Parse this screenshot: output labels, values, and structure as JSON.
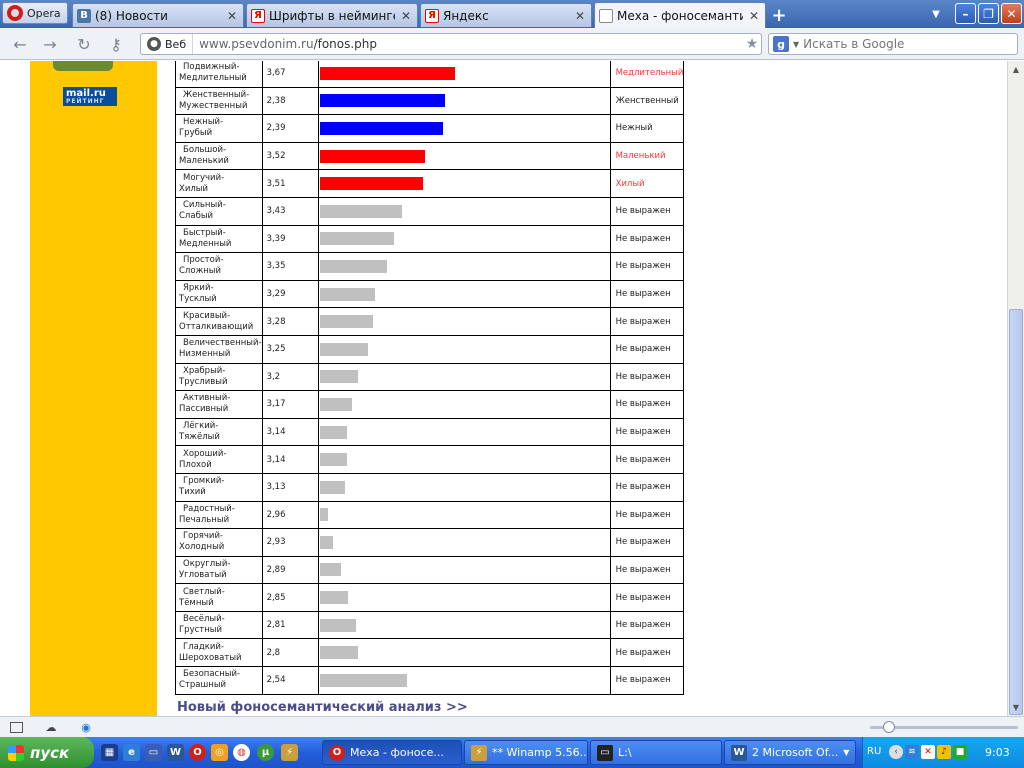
{
  "browser": {
    "menu_label": "Opera",
    "tabs": [
      {
        "label": "(8) Новости",
        "icon": "В"
      },
      {
        "label": "Шрифты в нейминге — ...",
        "icon": "Я"
      },
      {
        "label": "Яндекс",
        "icon": "Я"
      },
      {
        "label": "Меха - фоносемантичес...",
        "icon": "page"
      }
    ],
    "address": {
      "badge": "Веб",
      "domain": "www.psevdonim.ru",
      "path": "/fonos.php"
    },
    "search_placeholder": "Искать в Google"
  },
  "sidebar": {
    "logo_text": "mail.ru",
    "logo_sub": "РЕЙТИНГ"
  },
  "table": {
    "rows": [
      {
        "name1": "Подвижный-",
        "name2": "Медлительный",
        "value": "3,67",
        "bar": 3.67,
        "color": "#ff0000",
        "result": "Медлительный",
        "result_color": "#ff3333"
      },
      {
        "name1": "Женственный-",
        "name2": "Мужественный",
        "value": "2,38",
        "bar": 2.38,
        "color": "#0000ff",
        "result": "Женственный",
        "result_color": "#222222"
      },
      {
        "name1": "Нежный-",
        "name2": "Грубый",
        "value": "2,39",
        "bar": 2.39,
        "color": "#0000ff",
        "result": "Нежный",
        "result_color": "#222222"
      },
      {
        "name1": "Большой-",
        "name2": "Маленький",
        "value": "3,52",
        "bar": 3.52,
        "color": "#ff0000",
        "result": "Маленький",
        "result_color": "#ff3333"
      },
      {
        "name1": "Могучий-",
        "name2": "Хилый",
        "value": "3,51",
        "bar": 3.51,
        "color": "#ff0000",
        "result": "Хилый",
        "result_color": "#ff3333"
      },
      {
        "name1": "Сильный-",
        "name2": "Слабый",
        "value": "3,43",
        "bar": 3.43,
        "color": "#c0c0c0",
        "result": "Не выражен",
        "result_color": "#222222"
      },
      {
        "name1": "Быстрый-",
        "name2": "Медленный",
        "value": "3,39",
        "bar": 3.39,
        "color": "#c0c0c0",
        "result": "Не выражен",
        "result_color": "#222222"
      },
      {
        "name1": "Простой-",
        "name2": "Сложный",
        "value": "3,35",
        "bar": 3.35,
        "color": "#c0c0c0",
        "result": "Не выражен",
        "result_color": "#222222"
      },
      {
        "name1": "Яркий-",
        "name2": "Тусклый",
        "value": "3,29",
        "bar": 3.29,
        "color": "#c0c0c0",
        "result": "Не выражен",
        "result_color": "#222222"
      },
      {
        "name1": "Красивый-",
        "name2": "Отталкивающий",
        "value": "3,28",
        "bar": 3.28,
        "color": "#c0c0c0",
        "result": "Не выражен",
        "result_color": "#222222"
      },
      {
        "name1": "Величественный-",
        "name2": "Низменный",
        "value": "3,25",
        "bar": 3.25,
        "color": "#c0c0c0",
        "result": "Не выражен",
        "result_color": "#222222"
      },
      {
        "name1": "Храбрый-",
        "name2": "Трусливый",
        "value": "3,2",
        "bar": 3.2,
        "color": "#c0c0c0",
        "result": "Не выражен",
        "result_color": "#222222"
      },
      {
        "name1": "Активный-",
        "name2": "Пассивный",
        "value": "3,17",
        "bar": 3.17,
        "color": "#c0c0c0",
        "result": "Не выражен",
        "result_color": "#222222"
      },
      {
        "name1": "Лёгкий-",
        "name2": "Тяжёлый",
        "value": "3,14",
        "bar": 3.14,
        "color": "#c0c0c0",
        "result": "Не выражен",
        "result_color": "#222222"
      },
      {
        "name1": "Хороший-",
        "name2": "Плохой",
        "value": "3,14",
        "bar": 3.14,
        "color": "#c0c0c0",
        "result": "Не выражен",
        "result_color": "#222222"
      },
      {
        "name1": "Громкий-",
        "name2": "Тихий",
        "value": "3,13",
        "bar": 3.13,
        "color": "#c0c0c0",
        "result": "Не выражен",
        "result_color": "#222222"
      },
      {
        "name1": "Радостный-",
        "name2": "Печальный",
        "value": "2,96",
        "bar": 2.96,
        "color": "#c0c0c0",
        "result": "Не выражен",
        "result_color": "#222222"
      },
      {
        "name1": "Горячий-",
        "name2": "Холодный",
        "value": "2,93",
        "bar": 2.93,
        "color": "#c0c0c0",
        "result": "Не выражен",
        "result_color": "#222222"
      },
      {
        "name1": "Округлый-",
        "name2": "Угловатый",
        "value": "2,89",
        "bar": 2.89,
        "color": "#c0c0c0",
        "result": "Не выражен",
        "result_color": "#222222"
      },
      {
        "name1": "Светлый-",
        "name2": "Тёмный",
        "value": "2,85",
        "bar": 2.85,
        "color": "#c0c0c0",
        "result": "Не выражен",
        "result_color": "#222222"
      },
      {
        "name1": "Весёлый-",
        "name2": "Грустный",
        "value": "2,81",
        "bar": 2.81,
        "color": "#c0c0c0",
        "result": "Не выражен",
        "result_color": "#222222"
      },
      {
        "name1": "Гладкий-",
        "name2": "Шероховатый",
        "value": "2,8",
        "bar": 2.8,
        "color": "#c0c0c0",
        "result": "Не выражен",
        "result_color": "#222222"
      },
      {
        "name1": "Безопасный-",
        "name2": "Страшный",
        "value": "2,54",
        "bar": 2.54,
        "color": "#c0c0c0",
        "result": "Не выражен",
        "result_color": "#222222"
      }
    ]
  },
  "link": {
    "label": "Новый фоносемантический анализ >>"
  },
  "taskbar": {
    "start_label": "пуск",
    "tasks": [
      {
        "label": "Меха - фоносе...",
        "icon": "opera"
      },
      {
        "label": "** Winamp 5.56...",
        "icon": "winamp"
      },
      {
        "label": "L:\\",
        "icon": "folder"
      },
      {
        "label": "2 Microsoft Of...",
        "icon": "word"
      }
    ],
    "lang": "RU",
    "clock": "9:03"
  }
}
